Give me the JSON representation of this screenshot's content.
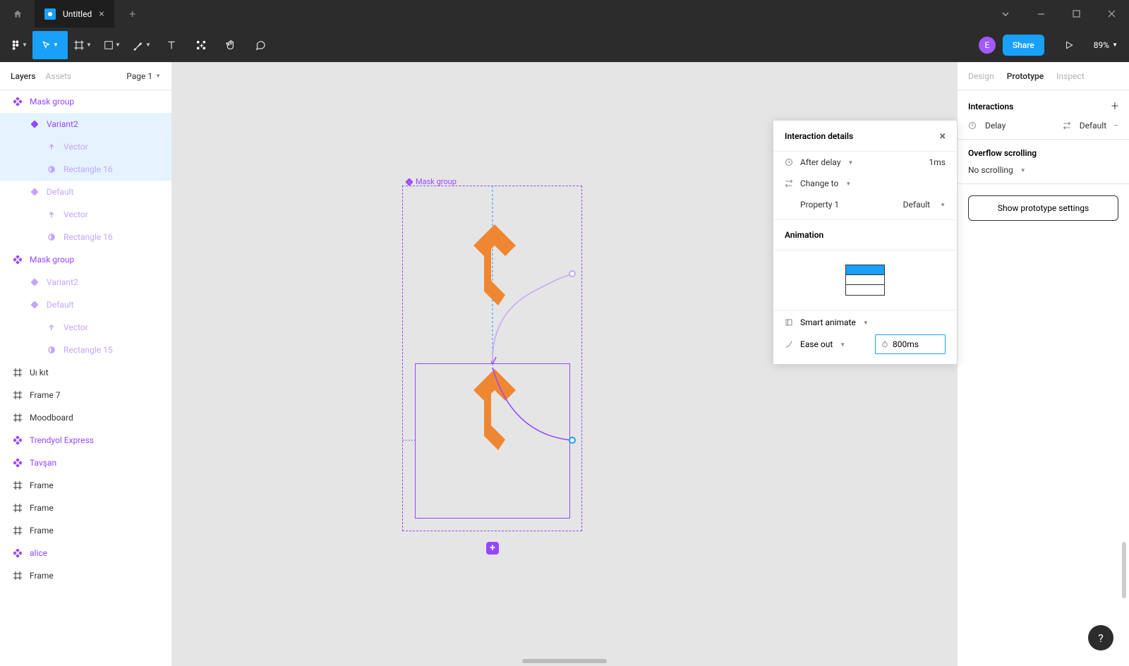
{
  "titlebar": {
    "tab_title": "Untitled"
  },
  "toolbar": {
    "avatar_initial": "E",
    "share_label": "Share",
    "zoom": "89%"
  },
  "left_panel": {
    "tabs": {
      "layers": "Layers",
      "assets": "Assets",
      "page": "Page 1"
    },
    "layers": [
      {
        "label": "Mask group",
        "type": "component",
        "color": "purple",
        "indent": 0,
        "selected": false
      },
      {
        "label": "Variant2",
        "type": "variant",
        "color": "purple",
        "indent": 1,
        "selected": true
      },
      {
        "label": "Vector",
        "type": "vector",
        "color": "purple-light",
        "indent": 2,
        "selected": true
      },
      {
        "label": "Rectangle 16",
        "type": "rect",
        "color": "purple-light",
        "indent": 2,
        "selected": true
      },
      {
        "label": "Default",
        "type": "variant",
        "color": "purple-light",
        "indent": 1,
        "selected": false
      },
      {
        "label": "Vector",
        "type": "vector",
        "color": "purple-light",
        "indent": 2,
        "selected": false
      },
      {
        "label": "Rectangle 16",
        "type": "rect",
        "color": "purple-light",
        "indent": 2,
        "selected": false
      },
      {
        "label": "Mask group",
        "type": "component",
        "color": "purple",
        "indent": 0,
        "selected": false
      },
      {
        "label": "Variant2",
        "type": "variant",
        "color": "purple-light",
        "indent": 1,
        "selected": false
      },
      {
        "label": "Default",
        "type": "variant",
        "color": "purple-light",
        "indent": 1,
        "selected": false
      },
      {
        "label": "Vector",
        "type": "vector",
        "color": "purple-light",
        "indent": 2,
        "selected": false
      },
      {
        "label": "Rectangle 15",
        "type": "rect",
        "color": "purple-light",
        "indent": 2,
        "selected": false
      },
      {
        "label": "Uı kıt",
        "type": "frame",
        "color": "gray",
        "indent": 0,
        "selected": false
      },
      {
        "label": "Frame 7",
        "type": "frame",
        "color": "gray",
        "indent": 0,
        "selected": false
      },
      {
        "label": "Moodboard",
        "type": "frame",
        "color": "gray",
        "indent": 0,
        "selected": false
      },
      {
        "label": "Trendyol Express",
        "type": "component",
        "color": "purple",
        "indent": 0,
        "selected": false
      },
      {
        "label": "Tavşan",
        "type": "component",
        "color": "purple",
        "indent": 0,
        "selected": false
      },
      {
        "label": "Frame",
        "type": "frame",
        "color": "gray",
        "indent": 0,
        "selected": false
      },
      {
        "label": "Frame",
        "type": "frame",
        "color": "gray",
        "indent": 0,
        "selected": false
      },
      {
        "label": "Frame",
        "type": "frame",
        "color": "gray",
        "indent": 0,
        "selected": false
      },
      {
        "label": "alice",
        "type": "component",
        "color": "purple",
        "indent": 0,
        "selected": false
      },
      {
        "label": "Frame",
        "type": "frame",
        "color": "gray",
        "indent": 0,
        "selected": false
      }
    ]
  },
  "canvas": {
    "label": "Mask group"
  },
  "right_panel": {
    "tabs": {
      "design": "Design",
      "prototype": "Prototype",
      "inspect": "Inspect"
    },
    "interactions_header": "Interactions",
    "interaction_row": {
      "trigger": "Delay",
      "action": "Default"
    },
    "overflow_header": "Overflow scrolling",
    "overflow_value": "No scrolling",
    "settings_button": "Show prototype settings"
  },
  "interaction_popup": {
    "title": "Interaction details",
    "trigger_label": "After delay",
    "trigger_value": "1ms",
    "action_label": "Change to",
    "property_label": "Property 1",
    "property_value": "Default",
    "animation_label": "Animation",
    "animation_type": "Smart animate",
    "easing": "Ease out",
    "duration": "800ms"
  },
  "colors": {
    "accent": "#18a0fb",
    "purple": "#9747ff",
    "orange": "#ef8732"
  }
}
